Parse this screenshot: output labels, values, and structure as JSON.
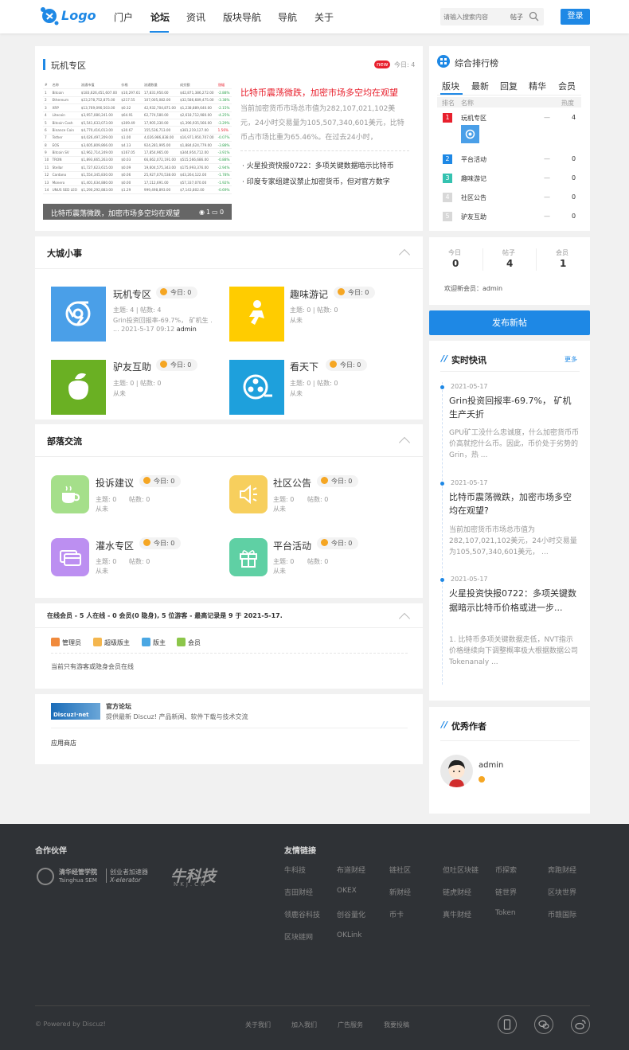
{
  "header": {
    "logo": "Logo",
    "nav": [
      "门户",
      "论坛",
      "资讯",
      "版块导航",
      "导航",
      "关于"
    ],
    "search_placeholder": "请输入搜索内容",
    "search_type": "帖子",
    "login": "登录"
  },
  "featured": {
    "section": "玩机专区",
    "badge": "new",
    "today": "今日: 4",
    "image_caption": "比特币震荡微跌，加密市场多空均在观望",
    "img_views": "1",
    "img_comments": "0",
    "headline": "比特币震荡微跌，加密市场多空均在观望",
    "summary": "当前加密货币市场总市值为282,107,021,102美元，24小时交易量为105,507,340,601美元，比特币占市场比重为65.46%。在过去24小时，",
    "links": [
      "火星投资快报0722：多项关键数据暗示比特币",
      "印度专家组建议禁止加密货币，但对官方数字"
    ]
  },
  "mini_table": {
    "headers": [
      "#",
      "名称",
      "流通市值",
      "价格",
      "流通数量",
      "成交额",
      "涨幅"
    ],
    "rows": [
      [
        "1",
        "Bitcoin",
        "$183,626,451,607.00",
        "$10,297.61",
        "17,831,950.00",
        "$42,871,386,272.00",
        "-2.88%"
      ],
      [
        "2",
        "Ethereum",
        "$23,278,752,875.00",
        "$217.55",
        "107,005,082.00",
        "$32,586,689,475.00",
        "-3.38%"
      ],
      [
        "3",
        "XRP",
        "$13,769,090,503.00",
        "$0.32",
        "42,932,704,871.00",
        "$1,238,889,640.00",
        "-2.15%"
      ],
      [
        "4",
        "Litecoin",
        "$3,957,080,241.00",
        "$64.91",
        "62,774,580.00",
        "$2,618,712,980.00",
        "-4.25%"
      ],
      [
        "5",
        "Bitcoin Cash",
        "$5,541,633,073.00",
        "$309.49",
        "17,905,330.00",
        "$1,396,935,566.00",
        "-3.29%"
      ],
      [
        "6",
        "Binance Coin",
        "$4,770,416,013.00",
        "$30.67",
        "155,536,713.00",
        "$381,219,127.00",
        "1.56%"
      ],
      [
        "7",
        "Tether",
        "$4,026,497,209.00",
        "$1.00",
        "4,026,986,838.00",
        "$16,971,950,707.00",
        "-0.07%"
      ],
      [
        "8",
        "EOS",
        "$3,605,809,866.00",
        "$4.13",
        "924,281,995.00",
        "$1,884,624,779.00",
        "-3.88%"
      ],
      [
        "9",
        "Bitcoin SV",
        "$2,962,714,249.00",
        "$167.05",
        "17,854,965.00",
        "$344,954,712.00",
        "-3.91%"
      ],
      [
        "10",
        "TRON",
        "$1,893,665,263.00",
        "$0.03",
        "66,662,072,191.00",
        "$515,566,686.00",
        "-0.88%"
      ],
      [
        "11",
        "Stellar",
        "$1,727,623,615.00",
        "$0.09",
        "19,604,575,343.00",
        "$175,993,376.00",
        "-2.94%"
      ],
      [
        "12",
        "Cardano",
        "$1,554,345,830.00",
        "$0.06",
        "25,927,070,538.00",
        "$43,264,122.00",
        "-1.78%"
      ],
      [
        "13",
        "Monero",
        "$1,401,634,880.00",
        "$0.00",
        "17,112,691.00",
        "$57,337,070.00",
        "-1.92%"
      ],
      [
        "14",
        "UNUS SED LEO",
        "$1,290,292,883.00",
        "$1.29",
        "999,498,893.00",
        "$7,143,802.00",
        "-0.69%"
      ]
    ]
  },
  "datong": {
    "title": "大城小事",
    "forums": [
      {
        "name": "玩机专区",
        "today": "今日: 0",
        "stats": "主题: 4 | 帖数: 4",
        "last": "Grin投资回报率-69.7%， 矿机生 ...",
        "time": "2021-5-17 09:12",
        "user": "admin"
      },
      {
        "name": "趣味游记",
        "today": "今日: 0",
        "stats": "主题: 0 | 帖数: 0",
        "last": "从未"
      },
      {
        "name": "驴友互助",
        "today": "今日: 0",
        "stats": "主题: 0 | 帖数: 0",
        "last": "从未"
      },
      {
        "name": "看天下",
        "today": "今日: 0",
        "stats": "主题: 0 | 帖数: 0",
        "last": "从未"
      }
    ]
  },
  "buluo": {
    "title": "部落交流",
    "forums": [
      {
        "name": "投诉建议",
        "today": "今日: 0",
        "topics": "主题: 0",
        "posts": "帖数: 0",
        "last": "从未"
      },
      {
        "name": "社区公告",
        "today": "今日: 0",
        "topics": "主题: 0",
        "posts": "帖数: 0",
        "last": "从未"
      },
      {
        "name": "灌水专区",
        "today": "今日: 0",
        "topics": "主题: 0",
        "posts": "帖数: 0",
        "last": "从未"
      },
      {
        "name": "平台活动",
        "today": "今日: 0",
        "topics": "主题: 0",
        "posts": "帖数: 0",
        "last": "从未"
      }
    ]
  },
  "online": {
    "summary": "在线会员 - 5 人在线 - 0 会员(0 隐身), 5 位游客 - 最高记录是 9 于 2021-5-17.",
    "legend": [
      "管理员",
      "超级版主",
      "版主",
      "会员"
    ],
    "note": "当前只有游客或隐身会员在线"
  },
  "official": {
    "title": "官方论坛",
    "desc": "提供最新 Discuz! 产品新闻、软件下载与技术交流",
    "logo_text": "Discuz!·net",
    "app_store": "应用商店"
  },
  "ranking": {
    "title": "综合排行榜",
    "tabs": [
      "版块",
      "最新",
      "回复",
      "精华",
      "会员"
    ],
    "col_rank": "排名",
    "col_name": "名称",
    "col_heat": "热度",
    "rows": [
      {
        "rank": "1",
        "name": "玩机专区",
        "dash": "—",
        "val": "4"
      },
      {
        "rank": "2",
        "name": "平台活动",
        "dash": "—",
        "val": "0"
      },
      {
        "rank": "3",
        "name": "趣味游记",
        "dash": "—",
        "val": "0"
      },
      {
        "rank": "4",
        "name": "社区公告",
        "dash": "—",
        "val": "0"
      },
      {
        "rank": "5",
        "name": "驴友互助",
        "dash": "—",
        "val": "0"
      }
    ]
  },
  "stats": {
    "labels": [
      "今日",
      "帖子",
      "会员"
    ],
    "values": [
      "0",
      "4",
      "1"
    ],
    "welcome": "欢迎新会员：",
    "welcome_user": "admin"
  },
  "post_button": "发布新帖",
  "news": {
    "title": "实时快讯",
    "more": "更多",
    "items": [
      {
        "date": "2021-05-17",
        "title": "Grin投资回报率-69.7%， 矿机生产夭折",
        "summary": "GPU矿工没什么忠诚度，什么加密货币币价高就挖什么币。因此，币价处于劣势的Grin，热 ..."
      },
      {
        "date": "2021-05-17",
        "title": "比特币震荡微跌，加密市场多空均在观望?",
        "summary": "当前加密货币市场总市值为282,107,021,102美元，24小时交易量为105,507,340,601美元， ..."
      },
      {
        "date": "2021-05-17",
        "title": "火星投资快报0722：多项关键数据暗示比特币价格或进一步...",
        "summary": "1. 比特币多项关键数据走低，NVT指示价格继续向下调整概率极大根据数据公司Tokenanaly ..."
      }
    ]
  },
  "authors": {
    "title": "优秀作者",
    "name": "admin"
  },
  "footer": {
    "partners_title": "合作伙伴",
    "partner1a": "清华经管学院",
    "partner1b": "Tsinghua SEM",
    "partner1c": "创业者加速器",
    "partner1d": "X-elerator",
    "partner2": "牛科技",
    "partner2b": "NKJ.CN",
    "links_title": "友情链接",
    "links": [
      "牛科技",
      "布道财经",
      "链社区",
      "但吐区块链",
      "币探索",
      "奔跑财经",
      "吉田财经",
      "OKEX",
      "新财经",
      "链虎财经",
      "链世界",
      "区块世界",
      "领鹿谷科技",
      "创谷量化",
      "币卡",
      "真牛财经",
      "Token",
      "币赣国际",
      "区块链网",
      "OKLink"
    ],
    "copyright": "© Powered by Discuz!",
    "bottom_links": [
      "关于我们",
      "加入我们",
      "广告服务",
      "我要投稿"
    ]
  },
  "colors": {
    "accent": "#1e88e5",
    "hot": "#e8202d",
    "footer_bg": "#2f3236"
  }
}
